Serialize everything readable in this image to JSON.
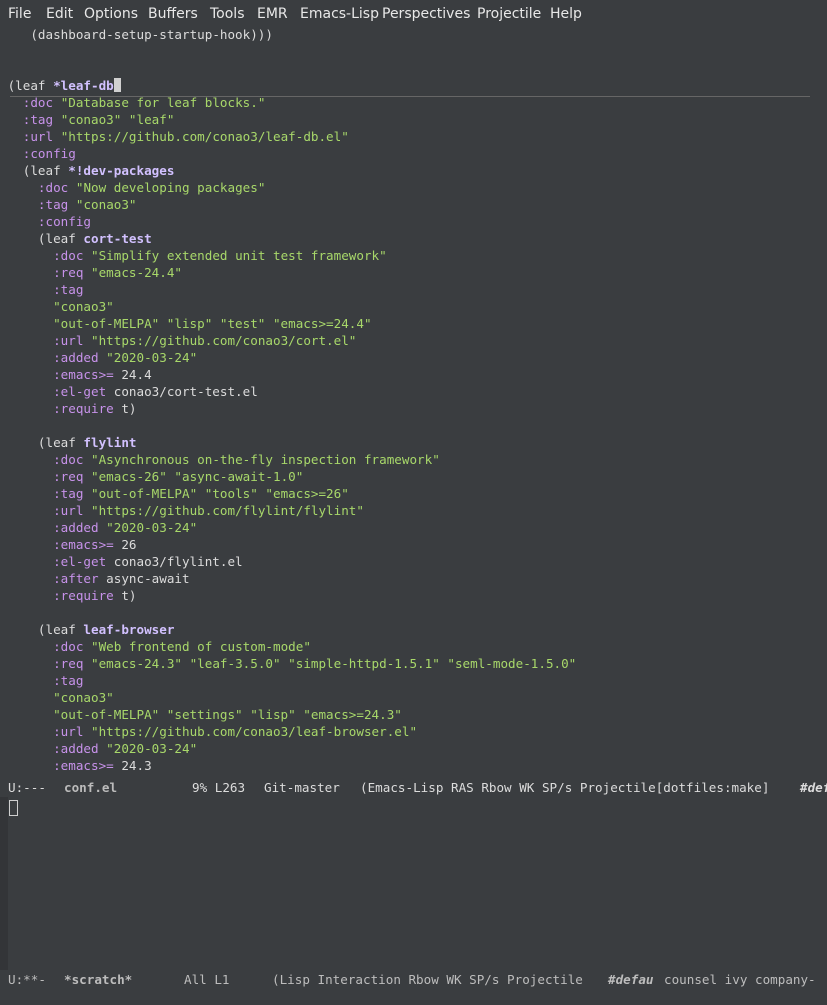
{
  "menubar": [
    "File",
    "Edit",
    "Options",
    "Buffers",
    "Tools",
    "EMR",
    "Emacs-Lisp",
    "Perspectives",
    "Projectile",
    "Help"
  ],
  "code_lines": [
    {
      "indent": "    ",
      "segs": [
        [
          "t",
          "(dashboard-setup-startup-hook)))"
        ]
      ]
    },
    {
      "indent": "",
      "segs": []
    },
    {
      "indent": "",
      "segs": []
    },
    {
      "indent": " ",
      "segs": [
        [
          "t",
          "(leaf "
        ],
        [
          "f",
          "*leaf-db"
        ],
        [
          "cursor",
          ""
        ]
      ]
    },
    {
      "indent": "   ",
      "segs": [
        [
          "k",
          ":doc"
        ],
        [
          "t",
          " "
        ],
        [
          "s",
          "\"Database for leaf blocks.\""
        ]
      ]
    },
    {
      "indent": "   ",
      "segs": [
        [
          "k",
          ":tag"
        ],
        [
          "t",
          " "
        ],
        [
          "s",
          "\"conao3\" \"leaf\""
        ]
      ]
    },
    {
      "indent": "   ",
      "segs": [
        [
          "k",
          ":url"
        ],
        [
          "t",
          " "
        ],
        [
          "s",
          "\"https://github.com/conao3/leaf-db.el\""
        ]
      ]
    },
    {
      "indent": "   ",
      "segs": [
        [
          "k",
          ":config"
        ]
      ]
    },
    {
      "indent": "   ",
      "segs": [
        [
          "t",
          "(leaf "
        ],
        [
          "f",
          "*!dev-packages"
        ]
      ]
    },
    {
      "indent": "     ",
      "segs": [
        [
          "k",
          ":doc"
        ],
        [
          "t",
          " "
        ],
        [
          "s",
          "\"Now developing packages\""
        ]
      ]
    },
    {
      "indent": "     ",
      "segs": [
        [
          "k",
          ":tag"
        ],
        [
          "t",
          " "
        ],
        [
          "s",
          "\"conao3\""
        ]
      ]
    },
    {
      "indent": "     ",
      "segs": [
        [
          "k",
          ":config"
        ]
      ]
    },
    {
      "indent": "     ",
      "segs": [
        [
          "t",
          "(leaf "
        ],
        [
          "f",
          "cort-test"
        ]
      ]
    },
    {
      "indent": "       ",
      "segs": [
        [
          "k",
          ":doc"
        ],
        [
          "t",
          " "
        ],
        [
          "s",
          "\"Simplify extended unit test framework\""
        ]
      ]
    },
    {
      "indent": "       ",
      "segs": [
        [
          "k",
          ":req"
        ],
        [
          "t",
          " "
        ],
        [
          "s",
          "\"emacs-24.4\""
        ]
      ]
    },
    {
      "indent": "       ",
      "segs": [
        [
          "k",
          ":tag"
        ]
      ]
    },
    {
      "indent": "       ",
      "segs": [
        [
          "s",
          "\"conao3\""
        ]
      ]
    },
    {
      "indent": "       ",
      "segs": [
        [
          "s",
          "\"out-of-MELPA\" \"lisp\" \"test\" \"emacs>=24.4\""
        ]
      ]
    },
    {
      "indent": "       ",
      "segs": [
        [
          "k",
          ":url"
        ],
        [
          "t",
          " "
        ],
        [
          "s",
          "\"https://github.com/conao3/cort.el\""
        ]
      ]
    },
    {
      "indent": "       ",
      "segs": [
        [
          "k",
          ":added"
        ],
        [
          "t",
          " "
        ],
        [
          "s",
          "\"2020-03-24\""
        ]
      ]
    },
    {
      "indent": "       ",
      "segs": [
        [
          "k",
          ":emacs>="
        ],
        [
          "t",
          " 24.4"
        ]
      ]
    },
    {
      "indent": "       ",
      "segs": [
        [
          "k",
          ":el-get"
        ],
        [
          "t",
          " conao3/cort-test.el"
        ]
      ]
    },
    {
      "indent": "       ",
      "segs": [
        [
          "k",
          ":require"
        ],
        [
          "t",
          " t)"
        ]
      ]
    },
    {
      "indent": "",
      "segs": []
    },
    {
      "indent": "     ",
      "segs": [
        [
          "t",
          "(leaf "
        ],
        [
          "f",
          "flylint"
        ]
      ]
    },
    {
      "indent": "       ",
      "segs": [
        [
          "k",
          ":doc"
        ],
        [
          "t",
          " "
        ],
        [
          "s",
          "\"Asynchronous on-the-fly inspection framework\""
        ]
      ]
    },
    {
      "indent": "       ",
      "segs": [
        [
          "k",
          ":req"
        ],
        [
          "t",
          " "
        ],
        [
          "s",
          "\"emacs-26\" \"async-await-1.0\""
        ]
      ]
    },
    {
      "indent": "       ",
      "segs": [
        [
          "k",
          ":tag"
        ],
        [
          "t",
          " "
        ],
        [
          "s",
          "\"out-of-MELPA\" \"tools\" \"emacs>=26\""
        ]
      ]
    },
    {
      "indent": "       ",
      "segs": [
        [
          "k",
          ":url"
        ],
        [
          "t",
          " "
        ],
        [
          "s",
          "\"https://github.com/flylint/flylint\""
        ]
      ]
    },
    {
      "indent": "       ",
      "segs": [
        [
          "k",
          ":added"
        ],
        [
          "t",
          " "
        ],
        [
          "s",
          "\"2020-03-24\""
        ]
      ]
    },
    {
      "indent": "       ",
      "segs": [
        [
          "k",
          ":emacs>="
        ],
        [
          "t",
          " 26"
        ]
      ]
    },
    {
      "indent": "       ",
      "segs": [
        [
          "k",
          ":el-get"
        ],
        [
          "t",
          " conao3/flylint.el"
        ]
      ]
    },
    {
      "indent": "       ",
      "segs": [
        [
          "k",
          ":after"
        ],
        [
          "t",
          " async-await"
        ]
      ]
    },
    {
      "indent": "       ",
      "segs": [
        [
          "k",
          ":require"
        ],
        [
          "t",
          " t)"
        ]
      ]
    },
    {
      "indent": "",
      "segs": []
    },
    {
      "indent": "     ",
      "segs": [
        [
          "t",
          "(leaf "
        ],
        [
          "f",
          "leaf-browser"
        ]
      ]
    },
    {
      "indent": "       ",
      "segs": [
        [
          "k",
          ":doc"
        ],
        [
          "t",
          " "
        ],
        [
          "s",
          "\"Web frontend of custom-mode\""
        ]
      ]
    },
    {
      "indent": "       ",
      "segs": [
        [
          "k",
          ":req"
        ],
        [
          "t",
          " "
        ],
        [
          "s",
          "\"emacs-24.3\" \"leaf-3.5.0\" \"simple-httpd-1.5.1\" \"seml-mode-1.5.0\""
        ]
      ]
    },
    {
      "indent": "       ",
      "segs": [
        [
          "k",
          ":tag"
        ]
      ]
    },
    {
      "indent": "       ",
      "segs": [
        [
          "s",
          "\"conao3\""
        ]
      ]
    },
    {
      "indent": "       ",
      "segs": [
        [
          "s",
          "\"out-of-MELPA\" \"settings\" \"lisp\" \"emacs>=24.3\""
        ]
      ]
    },
    {
      "indent": "       ",
      "segs": [
        [
          "k",
          ":url"
        ],
        [
          "t",
          " "
        ],
        [
          "s",
          "\"https://github.com/conao3/leaf-browser.el\""
        ]
      ]
    },
    {
      "indent": "       ",
      "segs": [
        [
          "k",
          ":added"
        ],
        [
          "t",
          " "
        ],
        [
          "s",
          "\"2020-03-24\""
        ]
      ]
    },
    {
      "indent": "       ",
      "segs": [
        [
          "k",
          ":emacs>="
        ],
        [
          "t",
          " 24.3"
        ]
      ]
    }
  ],
  "modeline_main": {
    "status": "U:---",
    "buffer": "conf.el",
    "position": "9% L263",
    "vcs": "Git-master",
    "modes": "(Emacs-Lisp RAS Rbow WK SP/s Projectile[dotfiles:make]",
    "persp": "#def"
  },
  "modeline_scratch": {
    "status": "U:**-",
    "buffer": "*scratch*",
    "position": "All L1",
    "modes_before": "(Lisp Interaction Rbow WK SP/s Projectile",
    "persp": "#defau",
    "modes_after": "counsel ivy company-"
  }
}
